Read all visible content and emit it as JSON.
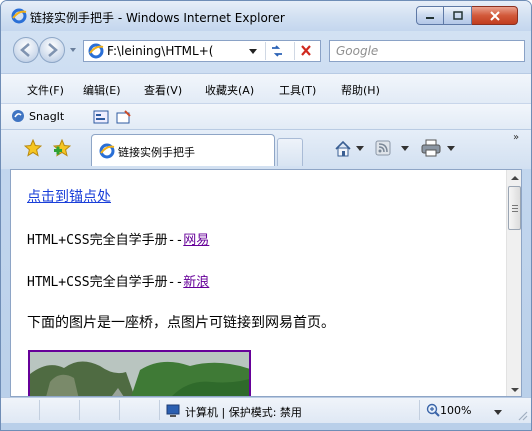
{
  "window": {
    "title": "链接实例手把手 - Windows Internet Explorer"
  },
  "addressbar": {
    "url": "F:\\leining\\HTML+(",
    "search_placeholder": "Google"
  },
  "menubar": {
    "items": [
      {
        "label": "文件(F)"
      },
      {
        "label": "编辑(E)"
      },
      {
        "label": "查看(V)"
      },
      {
        "label": "收藏夹(A)"
      },
      {
        "label": "工具(T)"
      },
      {
        "label": "帮助(H)"
      }
    ]
  },
  "snagit": {
    "label": "SnagIt"
  },
  "tabs": {
    "active_label": "链接实例手把手"
  },
  "toolbar": {
    "overflow": "»"
  },
  "page": {
    "anchor_link": "点击到锚点处",
    "line1_prefix": "HTML+CSS完全自学手册--",
    "line1_link": "网易",
    "line2_prefix": "HTML+CSS完全自学手册--",
    "line2_link": "新浪",
    "line3": "下面的图片是一座桥，点图片可链接到网易首页。"
  },
  "statusbar": {
    "zone": "计算机 | 保护模式: 禁用",
    "zoom": "100%"
  },
  "colors": {
    "link": "#1a3fd9",
    "visited_link": "#660099",
    "close_button": "#c13d1f"
  },
  "icons": {
    "ie": "ie-logo-icon",
    "back": "back-arrow-icon",
    "forward": "forward-arrow-icon",
    "refresh": "refresh-icon",
    "stop": "stop-icon",
    "favorites": "favorites-star-icon",
    "add_favorite": "add-favorite-icon",
    "home": "home-icon",
    "feeds": "feeds-icon",
    "print": "print-icon",
    "computer": "computer-icon",
    "zoom": "zoom-icon"
  }
}
